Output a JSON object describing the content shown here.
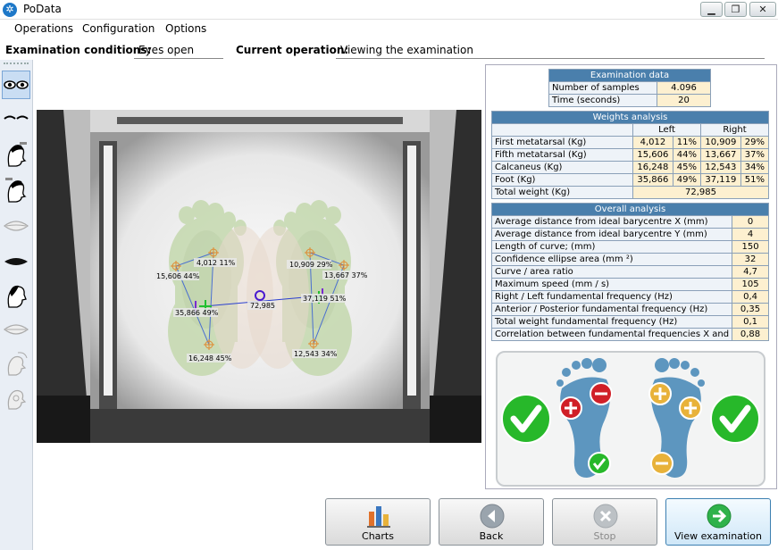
{
  "window": {
    "title": "PoData"
  },
  "menu": [
    "Operations",
    "Configuration",
    "Options"
  ],
  "status": {
    "exam_label": "Examination conditions:",
    "exam_value": "Eyes open",
    "op_label": "Current operation:",
    "op_value": "Viewing the examination"
  },
  "overlay_labels": [
    "4,012 11%",
    "15,606 44%",
    "35,866 49%",
    "16,248 45%",
    "72,985",
    "10,909 29%",
    "13,667 37%",
    "37,119 51%",
    "12,543 34%"
  ],
  "exam_data": {
    "title": "Examination data",
    "rows": [
      {
        "label": "Number of samples",
        "value": "4.096"
      },
      {
        "label": "Time (seconds)",
        "value": "20"
      }
    ]
  },
  "weights": {
    "title": "Weights analysis",
    "left_label": "Left",
    "right_label": "Right",
    "rows": [
      {
        "label": "First metatarsal (Kg)",
        "l": "4,012",
        "lp": "11%",
        "r": "10,909",
        "rp": "29%"
      },
      {
        "label": "Fifth metatarsal (Kg)",
        "l": "15,606",
        "lp": "44%",
        "r": "13,667",
        "rp": "37%"
      },
      {
        "label": "Calcaneus (Kg)",
        "l": "16,248",
        "lp": "45%",
        "r": "12,543",
        "rp": "34%"
      },
      {
        "label": "Foot (Kg)",
        "l": "35,866",
        "lp": "49%",
        "r": "37,119",
        "rp": "51%"
      }
    ],
    "total_label": "Total weight (Kg)",
    "total_value": "72,985"
  },
  "overall": {
    "title": "Overall analysis",
    "rows": [
      {
        "label": "Average distance from ideal barycentre X (mm)",
        "value": "0"
      },
      {
        "label": "Average distance from ideal barycentre Y (mm)",
        "value": "4"
      },
      {
        "label": "Length of curve; (mm)",
        "value": "150"
      },
      {
        "label": "Confidence ellipse area (mm ²)",
        "value": "32"
      },
      {
        "label": "Curve / area ratio",
        "value": "4,7"
      },
      {
        "label": "Maximum speed (mm / s)",
        "value": "105"
      },
      {
        "label": "Right / Left  fundamental frequency (Hz)",
        "value": "0,4"
      },
      {
        "label": "Anterior / Posterior fundamental frequency (Hz)",
        "value": "0,35"
      },
      {
        "label": "Total weight fundamental frequency (Hz)",
        "value": "0,1"
      },
      {
        "label": "Correlation between fundamental frequencies X and",
        "value": "0,88"
      }
    ]
  },
  "buttons": {
    "charts": "Charts",
    "back": "Back",
    "stop": "Stop",
    "view": "View examination"
  },
  "colors": {
    "header_blue": "#4a7fac",
    "value_cream": "#fdf0d0",
    "ok_green": "#27b82a",
    "minus_red": "#d01f27",
    "plus_gold": "#e8b23a",
    "foot_blue": "#5d96bf"
  }
}
